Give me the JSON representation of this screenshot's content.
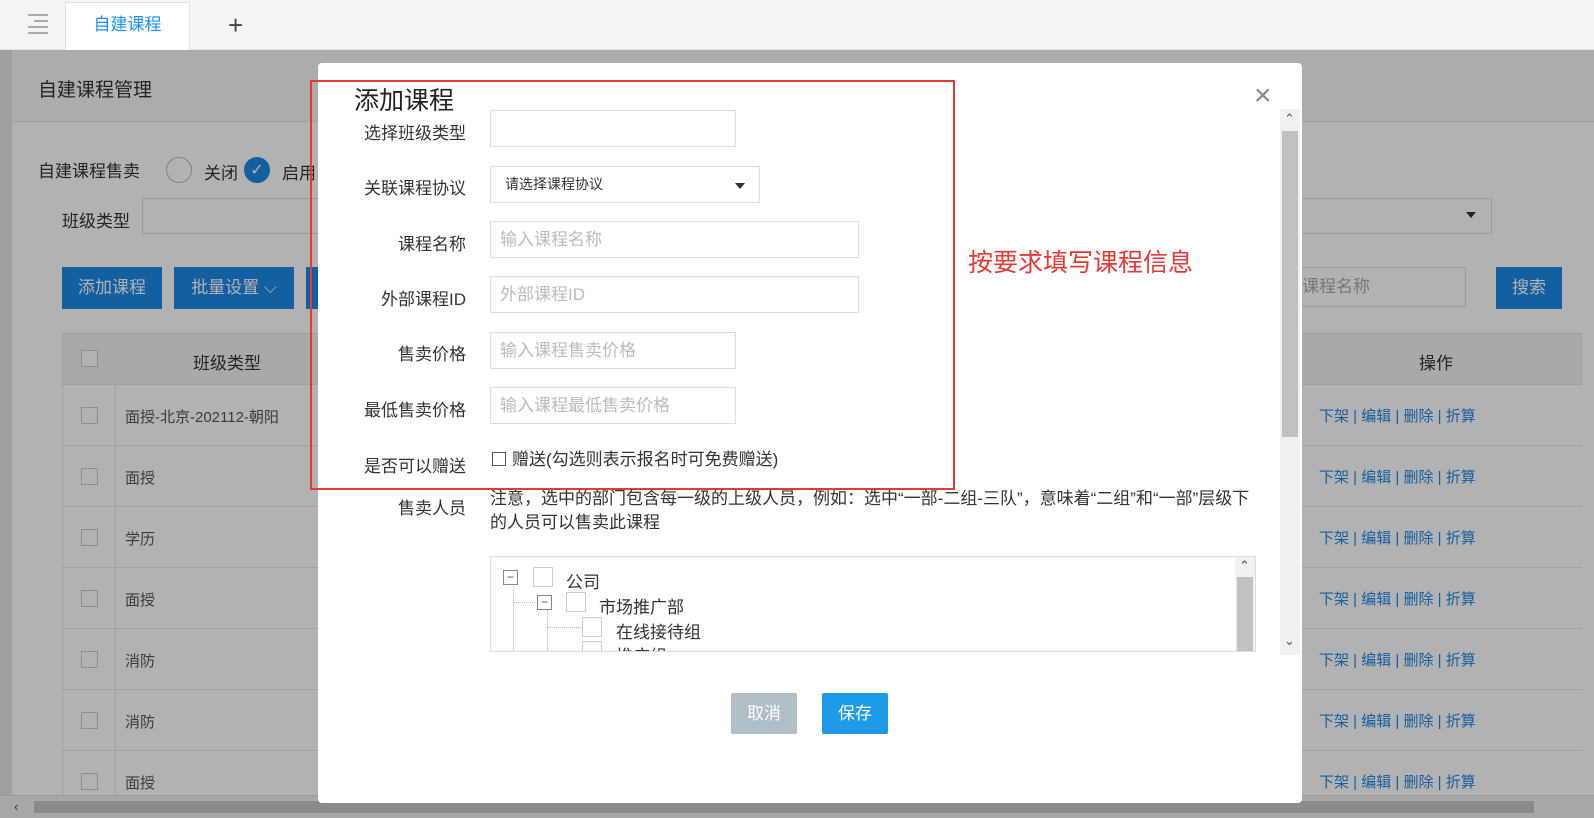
{
  "topbar": {
    "tab_label": "自建课程",
    "add_tab_symbol": "+"
  },
  "page": {
    "title": "自建课程管理",
    "sale_label": "自建课程售卖",
    "radio_off_label": "关闭",
    "radio_on_label": "启用",
    "class_type_label": "班级类型",
    "toolbar": {
      "add_course": "添加课程",
      "batch_settings": "批量设置 ⌵",
      "search_placeholder": "入课程名称",
      "search_button": "搜索"
    },
    "table": {
      "col_class_type": "班级类型",
      "col_actions": "操作",
      "rows": [
        {
          "class_type": "面授-北京-202112-朝阳",
          "actions": "下架 | 编辑 | 删除 | 折算"
        },
        {
          "class_type": "面授",
          "actions": "下架 | 编辑 | 删除 | 折算"
        },
        {
          "class_type": "学历",
          "actions": "下架 | 编辑 | 删除 | 折算"
        },
        {
          "class_type": "面授",
          "actions": "下架 | 编辑 | 删除 | 折算"
        },
        {
          "class_type": "消防",
          "actions": "下架 | 编辑 | 删除 | 折算"
        },
        {
          "class_type": "消防",
          "actions": "下架 | 编辑 | 删除 | 折算"
        },
        {
          "class_type": "面授",
          "actions": "下架 | 编辑 | 删除 | 折算"
        }
      ]
    }
  },
  "modal": {
    "title": "添加课程",
    "close_symbol": "×",
    "fields": {
      "class_type_label": "选择班级类型",
      "class_type_value": "",
      "agreement_label": "关联课程协议",
      "agreement_value": "请选择课程协议",
      "course_name_label": "课程名称",
      "course_name_placeholder": "输入课程名称",
      "external_id_label": "外部课程ID",
      "external_id_placeholder": "外部课程ID",
      "price_label": "售卖价格",
      "price_placeholder": "输入课程售卖价格",
      "min_price_label": "最低售卖价格",
      "min_price_placeholder": "输入课程最低售卖价格",
      "gift_label": "是否可以赠送",
      "gift_option": "赠送(勾选则表示报名时可免费赠送)",
      "sellers_label": "售卖人员",
      "sellers_note": "注意，选中的部门包含每一级的上级人员，例如：选中“一部-二组-三队”，意味着“二组”和“一部”层级下的人员可以售卖此课程"
    },
    "tree": [
      {
        "label": "公司"
      },
      {
        "label": "市场推广部"
      },
      {
        "label": "在线接待组"
      },
      {
        "label": "推广组"
      }
    ],
    "cancel_label": "取消",
    "save_label": "保存"
  },
  "annotation": {
    "text": "按要求填写课程信息",
    "color": "#e53935"
  },
  "colors": {
    "accent": "#1e88e5",
    "highlight": "#e53935",
    "cancel": "#b0bec5"
  }
}
